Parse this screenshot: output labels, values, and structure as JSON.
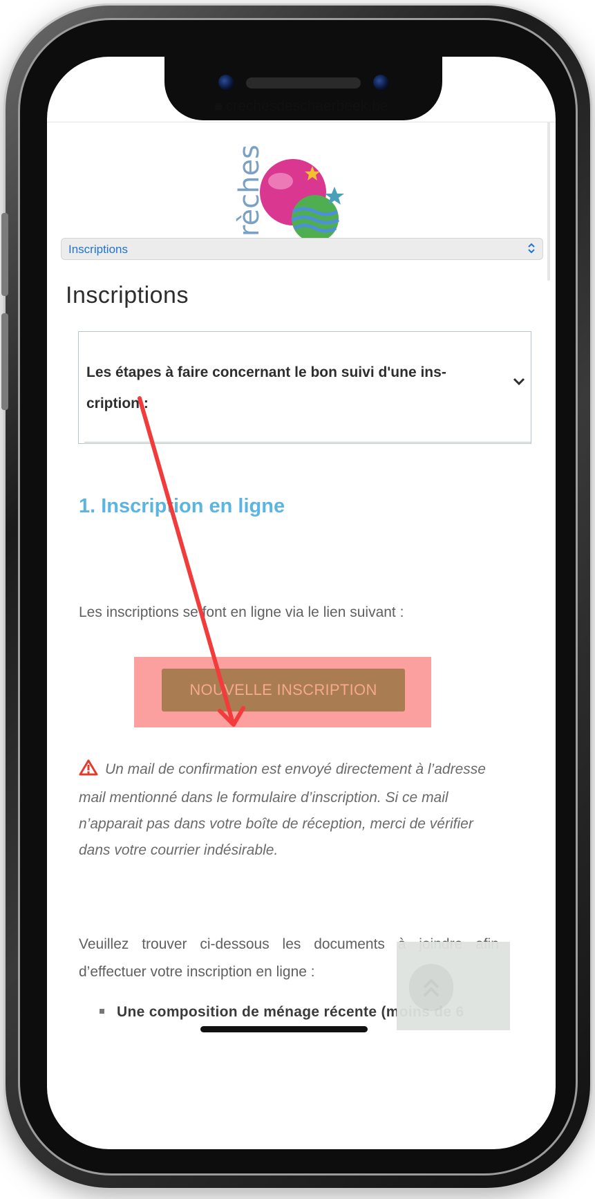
{
  "browser": {
    "url": "crechesdeschaerbeek.be"
  },
  "logo": {
    "text": "Crèches"
  },
  "nav_select": {
    "selected": "Inscriptions"
  },
  "page": {
    "title": "Inscriptions"
  },
  "accordion": {
    "title": "Les étapes à faire concernant le bon suivi d'une ins-cription :",
    "line1": "Les étapes à faire concernant le bon suivi d'une ins-",
    "line2": "cription :"
  },
  "section": {
    "heading": "1. Inscription en ligne",
    "intro": "Les inscriptions se font en ligne via le lien suivant :"
  },
  "cta": {
    "label": "NOUVELLE INSCRIPTION"
  },
  "warning": {
    "text": "Un mail de confirmation est envoyé directement à l’adresse mail mentionné dans le formulaire d’inscription. Si ce mail n’apparait pas dans votre boîte de réception, merci de vérifier dans votre courrier indésirable."
  },
  "documents": {
    "intro_word1": "Veuillez",
    "intro_word2": "trouver",
    "intro_word3": "ci-dessous",
    "intro_word4": "les",
    "intro_word5": "documents",
    "intro_word6": "à",
    "intro_word7": "joindre",
    "intro_word8": "afin",
    "intro_line2": "d’effectuer votre inscription en ligne :",
    "first_item": "Une composition de ménage récente (moins de 6"
  },
  "colors": {
    "section_heading": "#5cb5e0",
    "cta_bg": "#a97c52",
    "cta_text": "#f5a98f",
    "highlight": "#fc9f9f",
    "annotation_arrow": "#f23b3b",
    "select_text": "#1e74d0"
  },
  "icons": {
    "warning": "warning-triangle-icon",
    "accordion": "chevron-down-icon",
    "select": "updown-chevron-icon",
    "back_to_top": "double-chevron-up-icon",
    "lock": "lock-icon"
  }
}
